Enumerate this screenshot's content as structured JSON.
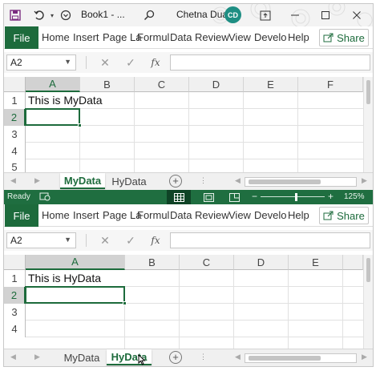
{
  "titlebar": {
    "doc_title": "Book1 - ...",
    "user_name": "Chetna Dua",
    "avatar_initials": "CD"
  },
  "ribbon": {
    "file_label": "File",
    "tabs": [
      "Home",
      "Insert",
      "Page La",
      "Formul",
      "Data",
      "Review",
      "View",
      "Develo",
      "Help"
    ],
    "share_label": "Share"
  },
  "windows": [
    {
      "name_box": "A2",
      "fx_label": "fx",
      "columns": [
        "A",
        "B",
        "C",
        "D",
        "E",
        "F"
      ],
      "rows": [
        "1",
        "2",
        "3",
        "4",
        "5"
      ],
      "cell_a1": "This is MyData",
      "sheet_tabs": [
        {
          "label": "MyData",
          "active": true
        },
        {
          "label": "HyData",
          "active": false
        }
      ]
    },
    {
      "name_box": "A2",
      "fx_label": "fx",
      "columns": [
        "A",
        "B",
        "C",
        "D",
        "E"
      ],
      "rows": [
        "1",
        "2",
        "3",
        "4"
      ],
      "cell_a1": "This is HyData",
      "sheet_tabs": [
        {
          "label": "MyData",
          "active": false
        },
        {
          "label": "HyData",
          "active": true
        }
      ]
    }
  ],
  "status_bar": {
    "ready": "Ready",
    "zoom_minus": "−",
    "zoom_plus": "+",
    "zoom_level": "125%"
  },
  "colors": {
    "accent": "#1d6b3c",
    "status_bg": "#1f6e40",
    "avatar": "#1e8e83"
  },
  "icons": [
    "save-icon",
    "undo-icon",
    "search-icon",
    "ribbon-display-icon",
    "minimize-icon",
    "maximize-icon",
    "close-icon",
    "share-icon",
    "cancel-icon",
    "enter-icon",
    "fx-icon",
    "normal-view-icon",
    "page-layout-icon",
    "page-break-icon",
    "accessibility-icon"
  ]
}
